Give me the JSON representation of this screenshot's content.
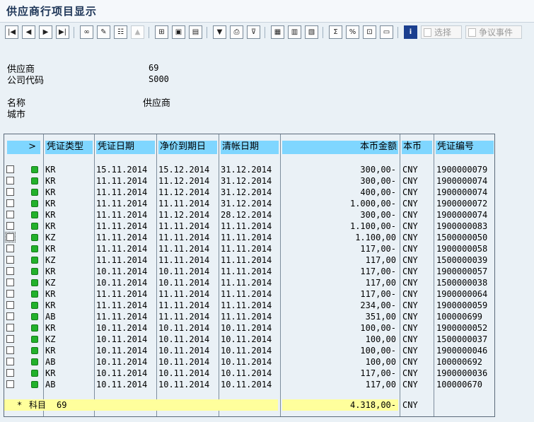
{
  "title": "供应商行项目显示",
  "toolbar": {
    "icons": [
      "first-page-icon",
      "prev-page-icon",
      "next-page-icon",
      "last-page-icon",
      "glasses-icon",
      "pencil-icon",
      "selection-icon",
      "disabled-icon",
      "choose-detail-icon",
      "display-doc-icon",
      "print-preview-icon",
      "filter-icon",
      "print-icon",
      "set-filter-icon",
      "layout-icon",
      "change-layout-icon",
      "save-layout-icon",
      "sum-icon",
      "subtotal-icon",
      "export-icon",
      "report-icon",
      "info-icon"
    ],
    "select_label": "选择",
    "dispute_label": "争议事件"
  },
  "header": {
    "vendor_label": "供应商",
    "vendor_value": "69",
    "company_label": "公司代码",
    "company_value": "S000",
    "name_label": "名称",
    "name_value": "供应商",
    "city_label": "城市"
  },
  "table": {
    "sel_header": ">",
    "columns": [
      "凭证类型",
      "凭证日期",
      "净价到期日",
      "清帐日期",
      "本币金额",
      "本币",
      "凭证编号"
    ],
    "rows": [
      [
        "KR",
        "15.11.2014",
        "15.12.2014",
        "31.12.2014",
        "300,00-",
        "CNY",
        "1900000079"
      ],
      [
        "KR",
        "11.11.2014",
        "11.12.2014",
        "31.12.2014",
        "300,00-",
        "CNY",
        "1900000074"
      ],
      [
        "KR",
        "11.11.2014",
        "11.12.2014",
        "31.12.2014",
        "400,00-",
        "CNY",
        "1900000074"
      ],
      [
        "KR",
        "11.11.2014",
        "11.11.2014",
        "31.12.2014",
        "1.000,00-",
        "CNY",
        "1900000072"
      ],
      [
        "KR",
        "11.11.2014",
        "11.12.2014",
        "28.12.2014",
        "300,00-",
        "CNY",
        "1900000074"
      ],
      [
        "KR",
        "11.11.2014",
        "11.11.2014",
        "11.11.2014",
        "1.100,00-",
        "CNY",
        "1900000083"
      ],
      [
        "KZ",
        "11.11.2014",
        "11.11.2014",
        "11.11.2014",
        "1.100,00",
        "CNY",
        "1500000050"
      ],
      [
        "KR",
        "11.11.2014",
        "11.11.2014",
        "11.11.2014",
        "117,00-",
        "CNY",
        "1900000058"
      ],
      [
        "KZ",
        "11.11.2014",
        "11.11.2014",
        "11.11.2014",
        "117,00",
        "CNY",
        "1500000039"
      ],
      [
        "KR",
        "10.11.2014",
        "10.11.2014",
        "11.11.2014",
        "117,00-",
        "CNY",
        "1900000057"
      ],
      [
        "KZ",
        "10.11.2014",
        "10.11.2014",
        "11.11.2014",
        "117,00",
        "CNY",
        "1500000038"
      ],
      [
        "KR",
        "11.11.2014",
        "11.11.2014",
        "11.11.2014",
        "117,00-",
        "CNY",
        "1900000064"
      ],
      [
        "KR",
        "11.11.2014",
        "11.11.2014",
        "11.11.2014",
        "234,00-",
        "CNY",
        "1900000059"
      ],
      [
        "AB",
        "11.11.2014",
        "11.11.2014",
        "11.11.2014",
        "351,00",
        "CNY",
        "100000699"
      ],
      [
        "KR",
        "10.11.2014",
        "10.11.2014",
        "10.11.2014",
        "100,00-",
        "CNY",
        "1900000052"
      ],
      [
        "KZ",
        "10.11.2014",
        "10.11.2014",
        "10.11.2014",
        "100,00",
        "CNY",
        "1500000037"
      ],
      [
        "KR",
        "10.11.2014",
        "10.11.2014",
        "10.11.2014",
        "100,00-",
        "CNY",
        "1900000046"
      ],
      [
        "AB",
        "10.11.2014",
        "10.11.2014",
        "10.11.2014",
        "100,00",
        "CNY",
        "100000692"
      ],
      [
        "KR",
        "10.11.2014",
        "10.11.2014",
        "10.11.2014",
        "117,00-",
        "CNY",
        "1900000036"
      ],
      [
        "AB",
        "10.11.2014",
        "10.11.2014",
        "10.11.2014",
        "117,00",
        "CNY",
        "100000670"
      ]
    ],
    "total": {
      "star": "*",
      "label": "科目",
      "account": "69",
      "amount": "4.318,00-",
      "currency": "CNY"
    }
  },
  "colors": {
    "header_band": "#7fd6ff",
    "status_green": "#22b12c",
    "total_highlight": "#ffff9c"
  }
}
